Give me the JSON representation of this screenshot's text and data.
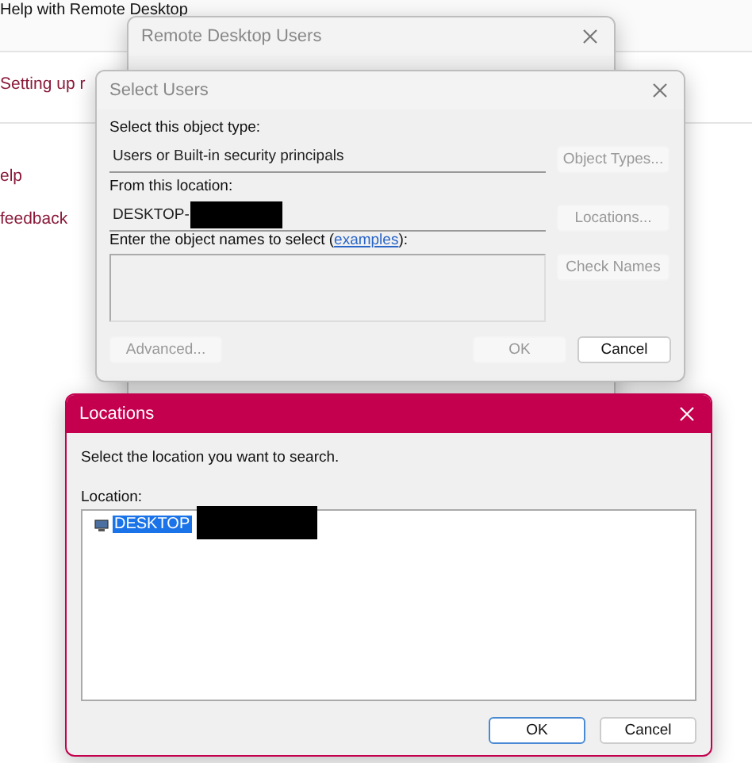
{
  "background_page": {
    "title": "Help with Remote Desktop",
    "links": [
      "Setting up r",
      "elp",
      "feedback"
    ]
  },
  "remote_desktop_users": {
    "title": "Remote Desktop Users",
    "active": false
  },
  "select_users": {
    "title": "Select Users",
    "active": false,
    "object_type_label": "Select this object type:",
    "object_type": "Users or Built-in security principals",
    "object_types_button": {
      "label": "Object Types...",
      "disabled": true
    },
    "location_label": "From this location:",
    "location": "DESKTOP-",
    "locations_button": {
      "label": "Locations...",
      "disabled": true
    },
    "names_label": "Enter the object names to select (",
    "names_link": "examples",
    "names_label_end": "):",
    "check_names_button": {
      "label": "Check Names",
      "disabled": true
    },
    "advanced_button": {
      "label": "Advanced...",
      "disabled": true
    },
    "ok_button": {
      "label": "OK",
      "disabled": true
    },
    "cancel_button": {
      "label": "Cancel",
      "disabled": false
    }
  },
  "locations": {
    "title": "Locations",
    "active": true,
    "prompt": "Select the location you want to search.",
    "tree_label": "Location:",
    "tree": [
      {
        "label": "DESKTOP",
        "selected": true
      }
    ],
    "ok_button": {
      "label": "OK",
      "default": true
    },
    "cancel_button": {
      "label": "Cancel",
      "default": false
    }
  }
}
